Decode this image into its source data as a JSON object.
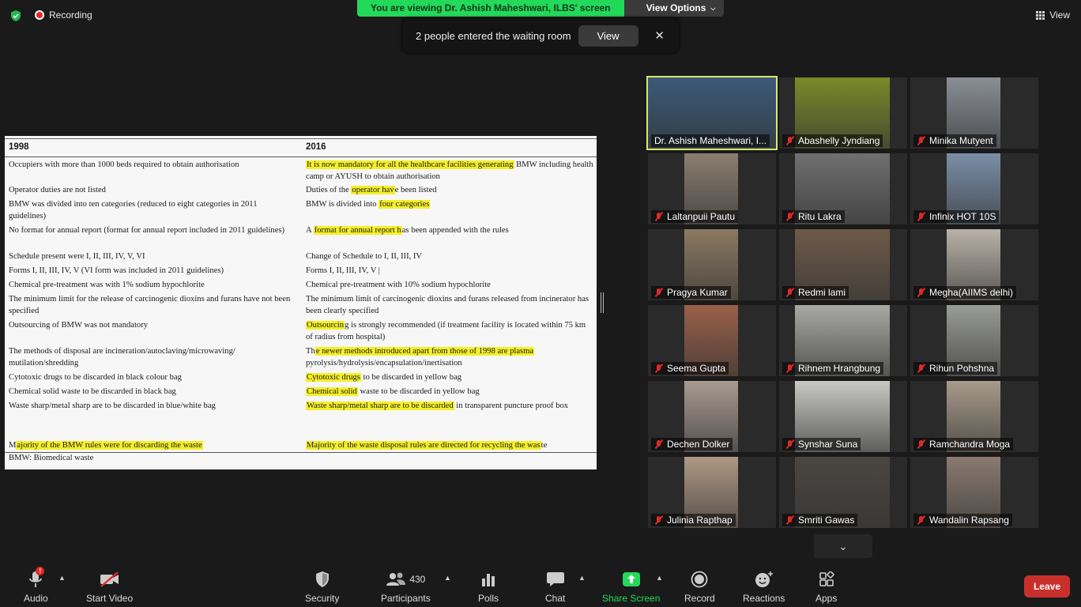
{
  "top": {
    "recording_label": "Recording",
    "banner_text": "You are viewing Dr. Ashish Maheshwari, ILBS' screen",
    "view_options_label": "View Options",
    "view_label": "View",
    "toast_text": "2 people entered the waiting room",
    "toast_view_label": "View",
    "toast_close": "✕"
  },
  "slide": {
    "col1_header": "1998",
    "col2_header": "2016",
    "footnote": "BMW: Biomedical waste",
    "rows": [
      {
        "c1": "Occupiers with more than 1000 beds required to obtain authorisation",
        "c2_pre": "",
        "c2_hl": "It is now mandatory for all the healthcare facilities generating",
        "c2_post": " BMW including health camp or AYUSH to obtain authorisation"
      },
      {
        "c1": "Operator duties are not listed",
        "c2_pre": "Duties of the ",
        "c2_hl": "operator hav",
        "c2_post": "e been listed"
      },
      {
        "c1": "BMW was divided into ten categories (reduced to eight categories in 2011 guidelines)",
        "c2_pre": "BMW is divided into ",
        "c2_hl": "four categories",
        "c2_post": ""
      },
      {
        "c1": "No format for annual report (format for annual report included in 2011 guidelines)",
        "c2_pre": "A ",
        "c2_hl": "format for annual report h",
        "c2_post": "as been appended with the rules"
      },
      {
        "c1": "Schedule present were I, II, III, IV, V, VI",
        "c2_pre": "Change of Schedule to I, II, III, IV",
        "c2_hl": "",
        "c2_post": ""
      },
      {
        "c1": "Forms I, II, III, IV, V (VI form was included in 2011 guidelines)",
        "c2_pre": "Forms I, II, III, IV, V |",
        "c2_hl": "",
        "c2_post": ""
      },
      {
        "c1": "Chemical pre-treatment was with 1% sodium hypochlorite",
        "c2_pre": "Chemical pre-treatment with 10% sodium hypochlorite",
        "c2_hl": "",
        "c2_post": ""
      },
      {
        "c1": "The minimum limit for the release of carcinogenic dioxins and furans have not been specified",
        "c2_pre": "The minimum limit of carcinogenic dioxins and furans released from incinerator has been clearly specified",
        "c2_hl": "",
        "c2_post": ""
      },
      {
        "c1": "Outsourcing of BMW was not mandatory",
        "c2_pre": "",
        "c2_hl": "Outsourcin",
        "c2_post": "g is strongly recommended (if treatment facility is located within 75 km of radius from hospital)"
      },
      {
        "c1": "The methods of disposal are incineration/autoclaving/microwaving/ mutilation/shredding",
        "c2_pre": "Th",
        "c2_hl": "e newer methods introduced apart from those of 1998 are plasma",
        "c2_post": " pyrolysis/hydrolysis/encapsulation/inertisation"
      },
      {
        "c1": "Cytotoxic drugs to be discarded in black colour bag",
        "c2_pre": "",
        "c2_hl": "Cytotoxic drugs",
        "c2_post": " to be discarded in yellow bag"
      },
      {
        "c1": "Chemical solid waste to be discarded in black bag",
        "c2_pre": "",
        "c2_hl": "Chemical solid",
        "c2_post": " waste to be discarded in yellow bag"
      },
      {
        "c1": "Waste sharp/metal sharp are to be discarded in blue/white bag",
        "c2_pre": "",
        "c2_hl": "Waste sharp/metal sharp are to be discarded",
        "c2_post": " in transparent puncture proof box"
      },
      {
        "c1_pre": "M",
        "c1_hl": "ajority of the BMW rules were for discarding the waste",
        "c2_pre": "",
        "c2_hl": "Majority of the waste disposal rules are directed for recycling the was",
        "c2_post": "te"
      }
    ]
  },
  "participants": [
    {
      "name": "Dr. Ashish Maheshwari, I...",
      "muted": false,
      "color": "#3b5a78",
      "active": true
    },
    {
      "name": "Abashelly Jyndiang",
      "muted": true,
      "color": "#7a8a2a"
    },
    {
      "name": "Minika Mutyent",
      "muted": true,
      "color": "#8a8f96"
    },
    {
      "name": "Laltanpuii Pautu",
      "muted": true,
      "color": "#8a7e70"
    },
    {
      "name": "Ritu Lakra",
      "muted": true,
      "color": "#707070"
    },
    {
      "name": "Infinix HOT 10S",
      "muted": true,
      "color": "#7a8fa8"
    },
    {
      "name": "Pragya Kumar",
      "muted": true,
      "color": "#8c7a62"
    },
    {
      "name": "Redmi lami",
      "muted": true,
      "color": "#6d5a48"
    },
    {
      "name": "Megha(AIIMS delhi)",
      "muted": true,
      "color": "#b8b2a8"
    },
    {
      "name": "Seema Gupta",
      "muted": true,
      "color": "#9a6048"
    },
    {
      "name": "Rihnem Hrangbung",
      "muted": true,
      "color": "#a8a8a4"
    },
    {
      "name": "Rihun Pohshna",
      "muted": true,
      "color": "#9a9c98"
    },
    {
      "name": "Dechen Dolker",
      "muted": true,
      "color": "#a89a90"
    },
    {
      "name": "Synshar Suna",
      "muted": true,
      "color": "#c8c8c4"
    },
    {
      "name": "Ramchandra Moga",
      "muted": true,
      "color": "#a89a8a"
    },
    {
      "name": "Julinia Rapthap",
      "muted": true,
      "color": "#b09884"
    },
    {
      "name": "Smriti Gawas",
      "muted": true,
      "color": "#4a4642"
    },
    {
      "name": "Wandalin Rapsang",
      "muted": true,
      "color": "#8a7a70"
    }
  ],
  "toolbar": {
    "audio": "Audio",
    "start_video": "Start Video",
    "security": "Security",
    "participants": "Participants",
    "participants_count": "430",
    "polls": "Polls",
    "chat": "Chat",
    "share_screen": "Share Screen",
    "record": "Record",
    "reactions": "Reactions",
    "apps": "Apps",
    "leave": "Leave",
    "audio_alert": "!"
  },
  "colors": {
    "share_green": "#23d959",
    "leave_red": "#c9302c",
    "highlight": "#f4ef2a"
  }
}
